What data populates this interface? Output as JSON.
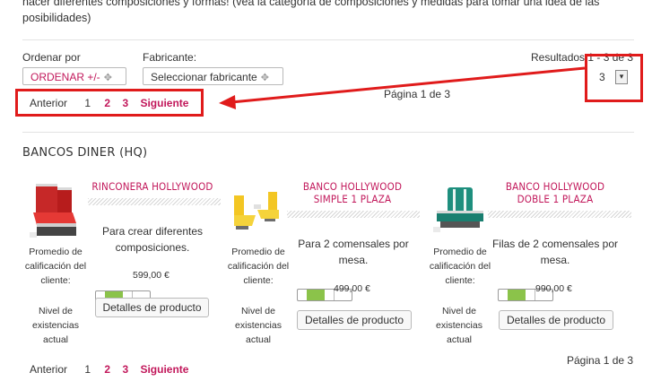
{
  "intro_text": "hacer diferentes composiciones y formas! (vea la categoría de composiciones y medidas para tomar una idea de las posibilidades)",
  "sort": {
    "label": "Ordenar por",
    "value": "ORDENAR +/-"
  },
  "manufacturer": {
    "label": "Fabricante:",
    "value": "Seleccionar fabricante"
  },
  "results": {
    "text": "Resultados 1 - 3 de 3",
    "per_page": "3"
  },
  "pagination_top": {
    "prev": "Anterior",
    "pages": [
      "1",
      "2",
      "3"
    ],
    "next": "Siguiente",
    "page_info": "Página 1 de 3"
  },
  "category_title": "BANCOS DINER (HQ)",
  "products": [
    {
      "name": "RINCONERA HOLLYWOOD",
      "description": "Para crear diferentes composiciones.",
      "price": "599,00 €",
      "rating_label": "Promedio de calificación del cliente:",
      "stock_label": "Nivel de existencias actual",
      "stock_level": 0.5,
      "details_button": "Detalles de producto",
      "image_icon": "red-corner-booth-icon"
    },
    {
      "name": "BANCO HOLLYWOOD SIMPLE 1 PLAZA",
      "description": "Para 2 comensales por mesa.",
      "price": "499,00 €",
      "rating_label": "Promedio de calificación del cliente:",
      "stock_label": "Nivel de existencias actual",
      "stock_level": 0.5,
      "details_button": "Detalles de producto",
      "image_icon": "yellow-single-seat-icon"
    },
    {
      "name": "BANCO HOLLYWOOD DOBLE 1 PLAZA",
      "description": "Filas de 2 comensales por mesa.",
      "price": "990,00 €",
      "rating_label": "Promedio de calificación del cliente:",
      "stock_label": "Nivel de existencias actual",
      "stock_level": 0.5,
      "details_button": "Detalles de producto",
      "image_icon": "teal-double-booth-icon"
    }
  ],
  "pagination_bottom": {
    "prev": "Anterior",
    "pages": [
      "1",
      "2",
      "3"
    ],
    "next": "Siguiente",
    "page_info": "Página 1 de 3"
  },
  "colors": {
    "accent": "#c2185b",
    "annotation": "#e01b1b",
    "stock_fill": "#8bc34a"
  }
}
